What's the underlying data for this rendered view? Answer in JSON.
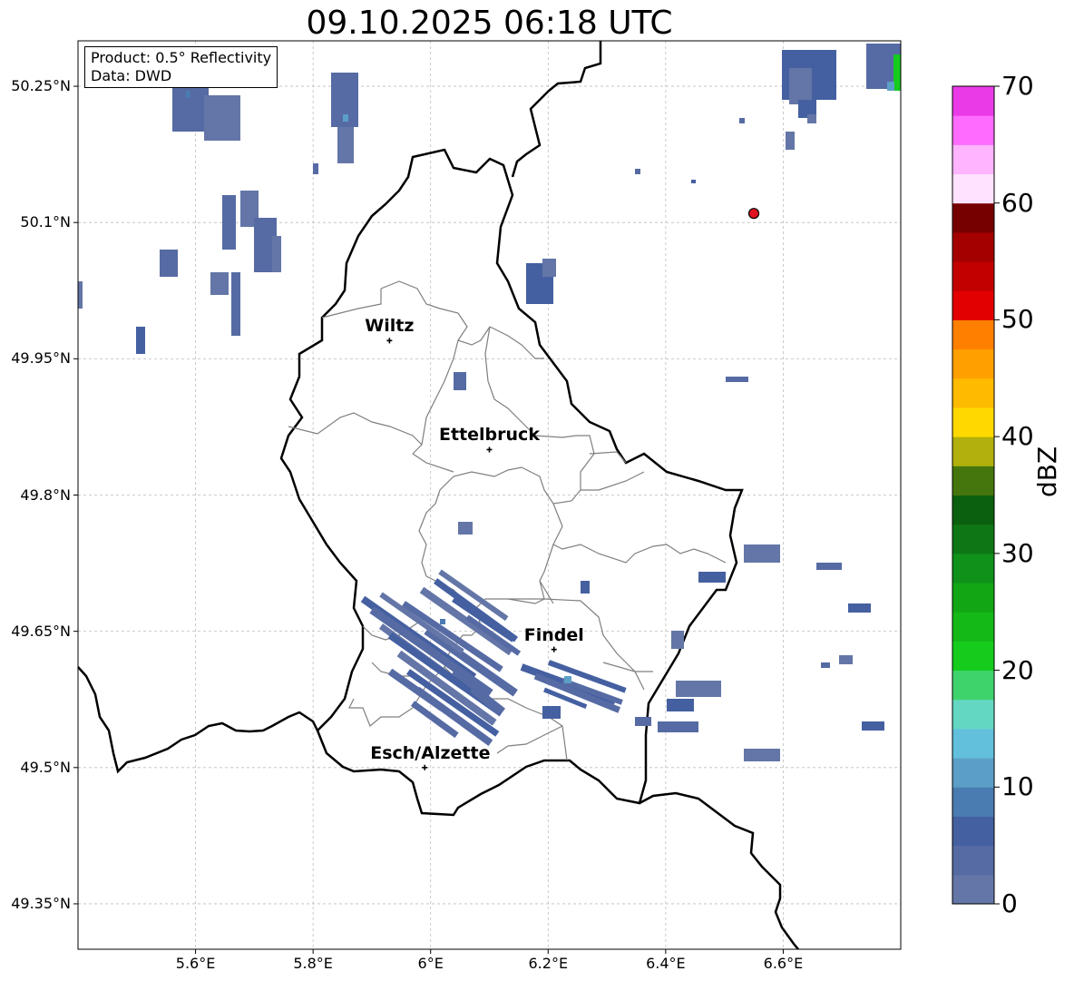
{
  "title": "09.10.2025 06:18 UTC",
  "info": {
    "product": "Product: 0.5° Reflectivity",
    "data": "Data: DWD"
  },
  "axes": {
    "lat_labels": [
      "50.25°N",
      "50.1°N",
      "49.95°N",
      "49.8°N",
      "49.65°N",
      "49.5°N",
      "49.35°N"
    ],
    "lon_labels": [
      "5.6°E",
      "5.8°E",
      "6°E",
      "6.2°E",
      "6.4°E",
      "6.6°E"
    ],
    "lon_range": [
      5.4,
      6.8
    ],
    "lat_range": [
      49.3,
      50.3
    ]
  },
  "cities": [
    {
      "name": "Wiltz",
      "lon": 5.93,
      "lat": 49.97
    },
    {
      "name": "Ettelbruck",
      "lon": 6.1,
      "lat": 49.85
    },
    {
      "name": "Findel",
      "lon": 6.21,
      "lat": 49.63
    },
    {
      "name": "Esch/Alzette",
      "lon": 5.99,
      "lat": 49.5
    }
  ],
  "radar_site": {
    "lon": 6.55,
    "lat": 50.11,
    "color": "#e0121f"
  },
  "colorbar": {
    "label": "dBZ",
    "ticks": [
      "0",
      "10",
      "20",
      "30",
      "40",
      "50",
      "60",
      "70"
    ],
    "colors": [
      "#6376a7",
      "#566ba4",
      "#4560a1",
      "#4a7bb1",
      "#5b9fc7",
      "#62c0dc",
      "#64d7c3",
      "#3fd36c",
      "#15cc1d",
      "#14b918",
      "#12a615",
      "#10911a",
      "#0e7714",
      "#0b600f",
      "#45760d",
      "#b1b00c",
      "#ffd800",
      "#ffbb00",
      "#ff9f00",
      "#ff8000",
      "#e20000",
      "#c30000",
      "#a40000",
      "#760000",
      "#ffe2ff",
      "#ffb4ff",
      "#ff6bff",
      "#ea3ae8"
    ]
  }
}
